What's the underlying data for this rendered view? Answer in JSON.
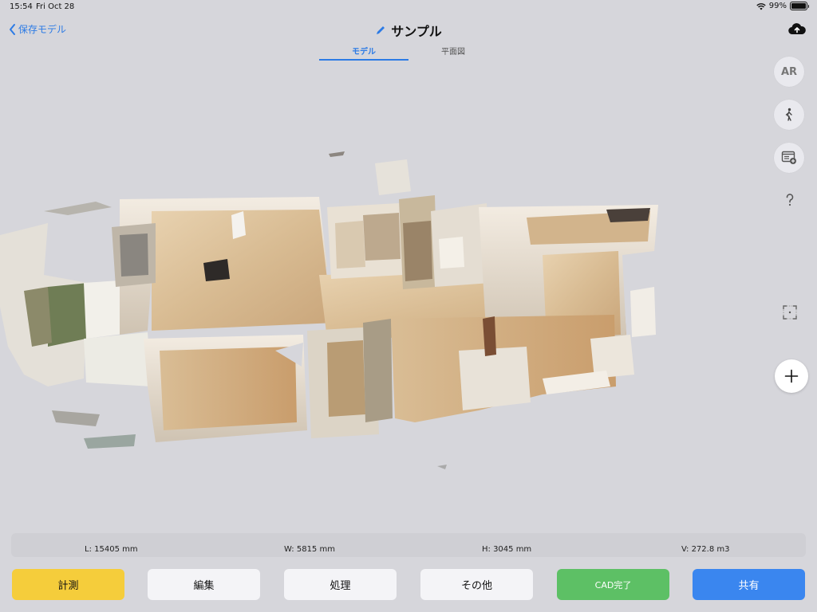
{
  "status": {
    "time": "15:54",
    "date": "Fri Oct 28",
    "battery": "99%",
    "battery_level": 0.99
  },
  "header": {
    "back_label": "保存モデル",
    "title": "サンプル"
  },
  "tabs": [
    {
      "label": "モデル",
      "active": true
    },
    {
      "label": "平面図",
      "active": false
    }
  ],
  "tools": {
    "ar_label": "AR"
  },
  "dimensions": {
    "length": "L: 15405 mm",
    "width": "W: 5815 mm",
    "height": "H: 3045 mm",
    "volume": "V: 272.8 m3"
  },
  "actions": {
    "measure": "計測",
    "edit": "編集",
    "process": "処理",
    "other": "その他",
    "cad": "CAD完了",
    "share": "共有"
  },
  "colors": {
    "accent": "#2c7be5",
    "measure_yellow": "#f5cd3b",
    "cad_green": "#5dc065",
    "share_blue": "#3a86ef",
    "background": "#d6d6db"
  }
}
